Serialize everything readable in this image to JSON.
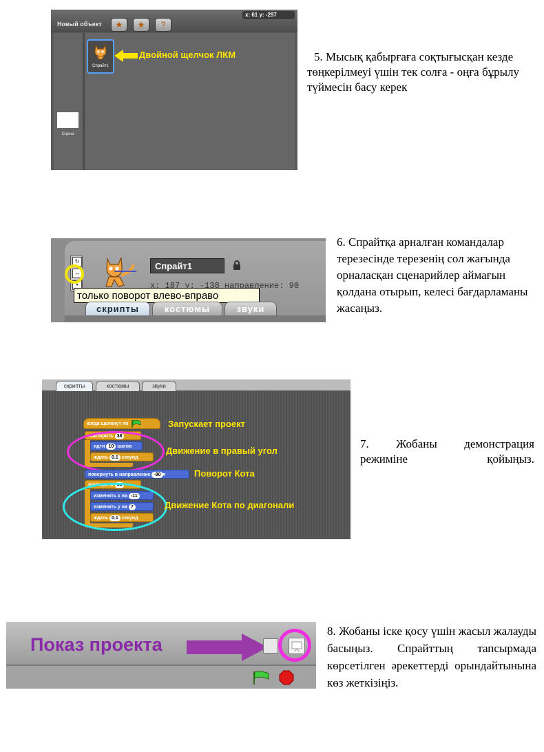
{
  "step5": {
    "screenshot": {
      "new_object_label": "Новый объект",
      "coords": "x: 61   y: -297",
      "sprite_label": "Спрайт1",
      "stage_label": "Сцена",
      "annotation": "Двойной щелчок ЛКМ"
    },
    "text": "5. Мысық қабырғаға соқтығысқан кезде төңкерілмеуі үшін тек солға - оңға бұрылу түймесін басу керек"
  },
  "step6": {
    "screenshot": {
      "sprite_name": "Спрайт1",
      "info": "x: 187   y: -138  направление: 90",
      "tooltip": "только поворот влево-вправо",
      "tabs": [
        "скрипты",
        "костюмы",
        "звуки"
      ]
    },
    "text": "6. Спрайтқа арналған командалар терезесінде терезенің сол жағында орналасқан сценарийлер аймағын қолдана отырып, келесі бағдарламаны жасаңыз."
  },
  "step7": {
    "screenshot": {
      "tabs": [
        "скрипты",
        "костюмы",
        "звуки"
      ],
      "blocks": {
        "when_flag": "когда щелкнут по",
        "repeat1_label": "повторить",
        "repeat1_value": "38",
        "move_label": "идти",
        "move_value": "10",
        "move_suffix": "шагов",
        "wait1_label": "ждать",
        "wait1_value": "0.1",
        "wait1_suffix": "секунд",
        "point_label": "повернуть в направление",
        "point_value": "-90",
        "repeat2_label": "повторить",
        "repeat2_value": "35",
        "changex_label": "изменить х на",
        "changex_value": "-11",
        "changey_label": "изменить у на",
        "changey_value": "7",
        "wait2_label": "ждать",
        "wait2_value": "0.1",
        "wait2_suffix": "секунд"
      },
      "annotations": {
        "start": "Запускает проект",
        "move_corner": "Движение в правый угол",
        "turn": "Поворот Кота",
        "diagonal": "Движение Кота по диагонали"
      }
    },
    "text": "7. Жобаны демонстрация режиміне қойыңыз."
  },
  "step8": {
    "screenshot": {
      "title": "Показ проекта"
    },
    "text": "8. Жобаны іске қосу үшін жасыл жалауды басыңыз. Спрайттың тапсырмада көрсетілген әрекеттерді орындайтынына көз жеткізіңіз."
  },
  "colors": {
    "annotation_yellow": "#ffe500",
    "magenta": "#ee2ee0",
    "cyan": "#2ee8e8",
    "purple_arrow": "#9a3aa8"
  }
}
